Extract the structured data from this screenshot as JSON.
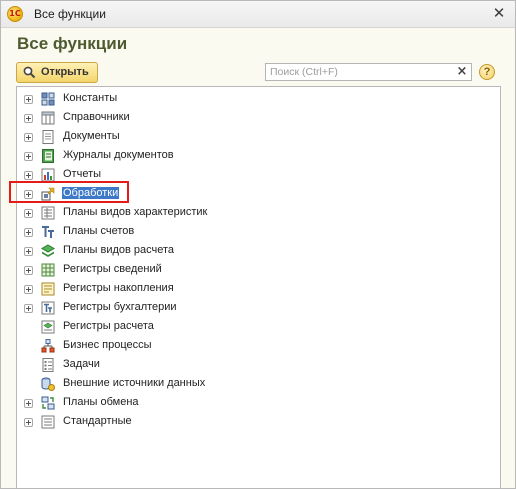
{
  "window": {
    "title": "Все функции",
    "logo_text": "1С"
  },
  "page": {
    "heading": "Все функции"
  },
  "toolbar": {
    "open_label": "Открыть",
    "search_placeholder": "Поиск (Ctrl+F)",
    "search_value": "",
    "clear_glyph": "×",
    "help_glyph": "?"
  },
  "tree": {
    "items": [
      {
        "label": "Константы",
        "icon": "constants-icon",
        "expandable": true,
        "selected": false
      },
      {
        "label": "Справочники",
        "icon": "catalogs-icon",
        "expandable": true,
        "selected": false
      },
      {
        "label": "Документы",
        "icon": "documents-icon",
        "expandable": true,
        "selected": false
      },
      {
        "label": "Журналы документов",
        "icon": "document-journals-icon",
        "expandable": true,
        "selected": false
      },
      {
        "label": "Отчеты",
        "icon": "reports-icon",
        "expandable": true,
        "selected": false
      },
      {
        "label": "Обработки",
        "icon": "data-processors-icon",
        "expandable": true,
        "selected": true
      },
      {
        "label": "Планы видов характеристик",
        "icon": "characteristic-types-icon",
        "expandable": true,
        "selected": false
      },
      {
        "label": "Планы счетов",
        "icon": "chart-of-accounts-icon",
        "expandable": true,
        "selected": false
      },
      {
        "label": "Планы видов расчета",
        "icon": "calculation-types-icon",
        "expandable": true,
        "selected": false
      },
      {
        "label": "Регистры сведений",
        "icon": "information-registers-icon",
        "expandable": true,
        "selected": false
      },
      {
        "label": "Регистры накопления",
        "icon": "accumulation-registers-icon",
        "expandable": true,
        "selected": false
      },
      {
        "label": "Регистры бухгалтерии",
        "icon": "accounting-registers-icon",
        "expandable": true,
        "selected": false
      },
      {
        "label": "Регистры расчета",
        "icon": "calculation-registers-icon",
        "expandable": false,
        "selected": false
      },
      {
        "label": "Бизнес процессы",
        "icon": "business-processes-icon",
        "expandable": false,
        "selected": false
      },
      {
        "label": "Задачи",
        "icon": "tasks-icon",
        "expandable": false,
        "selected": false
      },
      {
        "label": "Внешние источники данных",
        "icon": "external-data-sources-icon",
        "expandable": false,
        "selected": false
      },
      {
        "label": "Планы обмена",
        "icon": "exchange-plans-icon",
        "expandable": true,
        "selected": false
      },
      {
        "label": "Стандартные",
        "icon": "standard-icon",
        "expandable": true,
        "selected": false
      }
    ]
  },
  "colors": {
    "heading": "#4e5a2f",
    "selection": "#3d79c8",
    "highlight_frame": "#e41b1b",
    "button_fill": "#f4d46a"
  }
}
